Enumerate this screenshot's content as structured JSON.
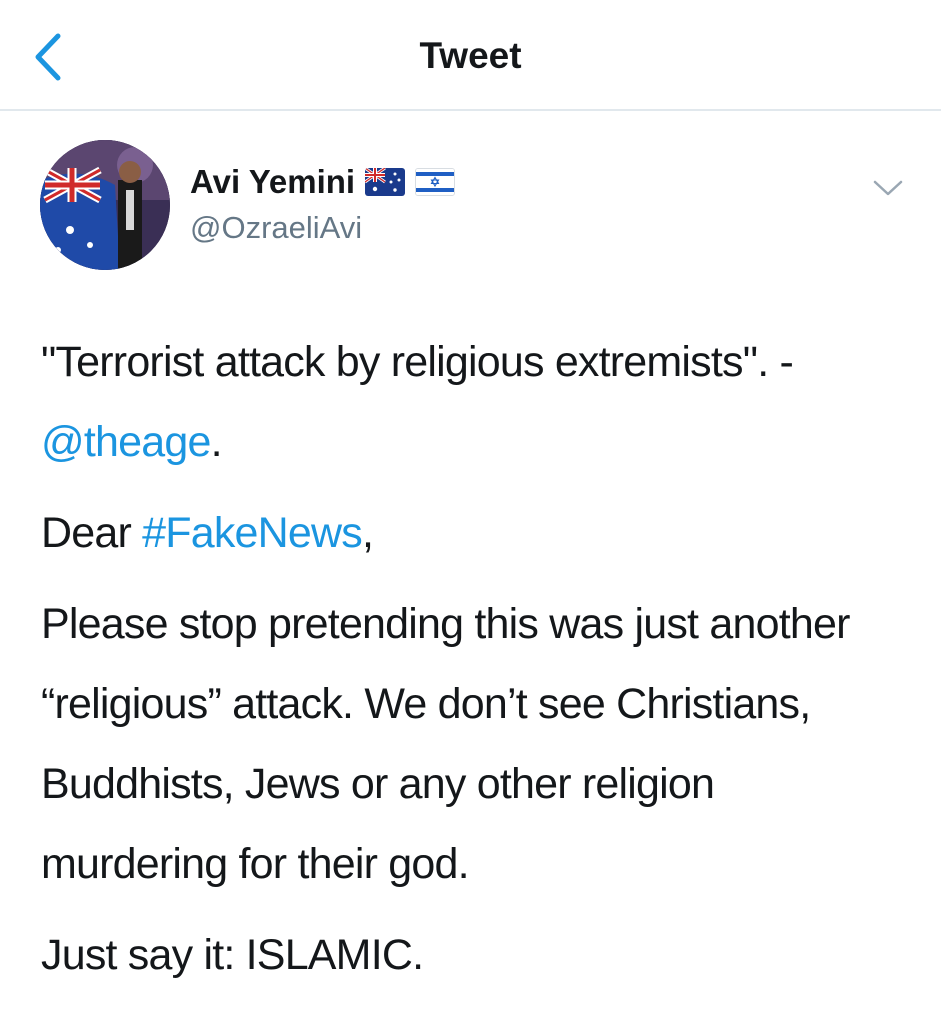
{
  "header": {
    "title": "Tweet"
  },
  "author": {
    "display_name": "Avi Yemini",
    "handle": "@OzraeliAvi",
    "flags": [
      "australia-flag",
      "israel-flag"
    ]
  },
  "tweet": {
    "line1_pre": "\"Terrorist attack by religious extremists\". - ",
    "mention": "@theage",
    "line1_post": ".",
    "para2_pre": "Dear ",
    "hashtag": "#FakeNews",
    "para2_post": ",",
    "para3": "Please stop pretending this was just another “religious” attack. We don’t see Christians, Buddhists, Jews or any other religion murdering for their god.",
    "para4": "Just say it: ISLAMIC."
  },
  "colors": {
    "accent": "#1b95e0",
    "text": "#14171a",
    "secondary": "#657786",
    "divider": "#e1e8ed"
  }
}
